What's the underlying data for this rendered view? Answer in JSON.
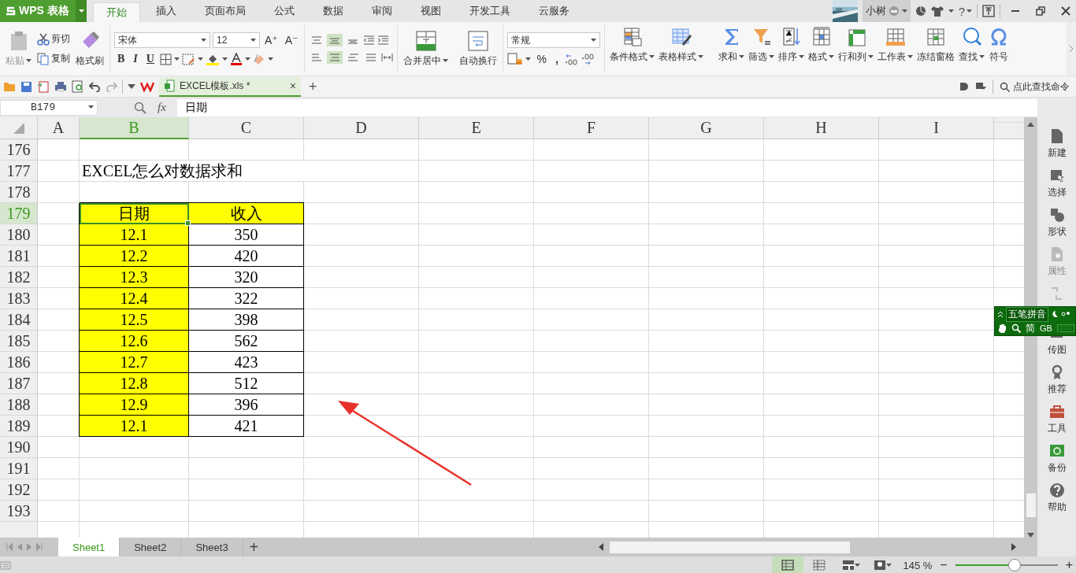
{
  "app": {
    "logo": "WPS 表格"
  },
  "menu_tabs": [
    {
      "label": "开始",
      "selected": true
    },
    {
      "label": "插入",
      "selected": false
    },
    {
      "label": "页面布局",
      "selected": false
    },
    {
      "label": "公式",
      "selected": false
    },
    {
      "label": "数据",
      "selected": false
    },
    {
      "label": "审阅",
      "selected": false
    },
    {
      "label": "视图",
      "selected": false
    },
    {
      "label": "开发工具",
      "selected": false
    },
    {
      "label": "云服务",
      "selected": false
    }
  ],
  "account": {
    "name": "小树",
    "help": "?"
  },
  "ribbon": {
    "clipboard": {
      "paste": "粘贴",
      "cut": "剪切",
      "copy": "复制",
      "format_painter": "格式刷"
    },
    "font": {
      "name": "宋体",
      "size": "12",
      "grow": "A⁺",
      "shrink": "A⁻",
      "bold": "B",
      "italic": "I",
      "underline": "U"
    },
    "alignment": {
      "merge": "合并居中",
      "wrap": "自动换行"
    },
    "number": {
      "format": "常规",
      "percent": "%",
      "comma": ","
    },
    "tools": [
      {
        "label": "条件格式",
        "dropdown": true
      },
      {
        "label": "表格样式",
        "dropdown": true
      },
      {
        "label": "求和",
        "dropdown": true
      },
      {
        "label": "筛选",
        "dropdown": true
      },
      {
        "label": "排序",
        "dropdown": true
      },
      {
        "label": "格式",
        "dropdown": true
      },
      {
        "label": "行和列",
        "dropdown": true
      },
      {
        "label": "工作表",
        "dropdown": true
      },
      {
        "label": "冻结窗格",
        "dropdown": false
      },
      {
        "label": "查找",
        "dropdown": true
      },
      {
        "label": "符号",
        "dropdown": false
      }
    ]
  },
  "document_tab": {
    "title": "EXCEL模板.xls *",
    "close": "×",
    "new": "+"
  },
  "command_search": {
    "placeholder": "点此查找命令"
  },
  "formula_bar": {
    "cell": "B179",
    "fx": "fx",
    "value": "日期"
  },
  "columns": [
    {
      "label": "A",
      "selected": false
    },
    {
      "label": "B",
      "selected": true
    },
    {
      "label": "C",
      "selected": false
    },
    {
      "label": "D",
      "selected": false
    },
    {
      "label": "E",
      "selected": false
    },
    {
      "label": "F",
      "selected": false
    },
    {
      "label": "G",
      "selected": false
    },
    {
      "label": "H",
      "selected": false
    },
    {
      "label": "I",
      "selected": false
    }
  ],
  "rows": [
    {
      "number": "176",
      "selected": false
    },
    {
      "number": "177",
      "selected": false,
      "column_b": {
        "text": "EXCEL怎么对数据求和",
        "highlighted": false,
        "bordered": false,
        "selected": false
      }
    },
    {
      "number": "178",
      "selected": false
    },
    {
      "number": "179",
      "selected": true,
      "column_b": {
        "text": "日期",
        "highlighted": true,
        "bordered": true,
        "selected": true
      },
      "column_c": {
        "text": "收入",
        "highlighted": true,
        "bordered": true,
        "selected": false
      }
    },
    {
      "number": "180",
      "selected": false,
      "column_b": {
        "text": "12.1",
        "highlighted": true,
        "bordered": true,
        "selected": false
      },
      "column_c": {
        "text": "350",
        "highlighted": false,
        "bordered": true,
        "selected": false
      }
    },
    {
      "number": "181",
      "selected": false,
      "column_b": {
        "text": "12.2",
        "highlighted": true,
        "bordered": true,
        "selected": false
      },
      "column_c": {
        "text": "420",
        "highlighted": false,
        "bordered": true,
        "selected": false
      }
    },
    {
      "number": "182",
      "selected": false,
      "column_b": {
        "text": "12.3",
        "highlighted": true,
        "bordered": true,
        "selected": false
      },
      "column_c": {
        "text": "320",
        "highlighted": false,
        "bordered": true,
        "selected": false
      }
    },
    {
      "number": "183",
      "selected": false,
      "column_b": {
        "text": "12.4",
        "highlighted": true,
        "bordered": true,
        "selected": false
      },
      "column_c": {
        "text": "322",
        "highlighted": false,
        "bordered": true,
        "selected": false
      }
    },
    {
      "number": "184",
      "selected": false,
      "column_b": {
        "text": "12.5",
        "highlighted": true,
        "bordered": true,
        "selected": false
      },
      "column_c": {
        "text": "398",
        "highlighted": false,
        "bordered": true,
        "selected": false
      }
    },
    {
      "number": "185",
      "selected": false,
      "column_b": {
        "text": "12.6",
        "highlighted": true,
        "bordered": true,
        "selected": false
      },
      "column_c": {
        "text": "562",
        "highlighted": false,
        "bordered": true,
        "selected": false
      }
    },
    {
      "number": "186",
      "selected": false,
      "column_b": {
        "text": "12.7",
        "highlighted": true,
        "bordered": true,
        "selected": false
      },
      "column_c": {
        "text": "423",
        "highlighted": false,
        "bordered": true,
        "selected": false
      }
    },
    {
      "number": "187",
      "selected": false,
      "column_b": {
        "text": "12.8",
        "highlighted": true,
        "bordered": true,
        "selected": false
      },
      "column_c": {
        "text": "512",
        "highlighted": false,
        "bordered": true,
        "selected": false
      }
    },
    {
      "number": "188",
      "selected": false,
      "column_b": {
        "text": "12.9",
        "highlighted": true,
        "bordered": true,
        "selected": false
      },
      "column_c": {
        "text": "396",
        "highlighted": false,
        "bordered": true,
        "selected": false
      }
    },
    {
      "number": "189",
      "selected": false,
      "column_b": {
        "text": "12.1",
        "highlighted": true,
        "bordered": true,
        "selected": false
      },
      "column_c": {
        "text": "421",
        "highlighted": false,
        "bordered": true,
        "selected": false
      }
    },
    {
      "number": "190",
      "selected": false
    },
    {
      "number": "191",
      "selected": false
    },
    {
      "number": "192",
      "selected": false
    },
    {
      "number": "193",
      "selected": false
    }
  ],
  "sidebar": [
    {
      "label": "新建",
      "disabled": false
    },
    {
      "label": "选择",
      "disabled": false
    },
    {
      "label": "形状",
      "disabled": false
    },
    {
      "label": "属性",
      "disabled": true
    },
    {
      "disabled": true
    },
    {
      "label": "传图",
      "disabled": false
    },
    {
      "label": "推荐",
      "disabled": false
    },
    {
      "label": "工具",
      "disabled": false
    },
    {
      "label": "备份",
      "disabled": false
    },
    {
      "label": "帮助",
      "disabled": false
    }
  ],
  "input_method": {
    "name": "五笔拼音",
    "mode": "简",
    "charset": "GB"
  },
  "sheet_tabs": [
    {
      "label": "Sheet1",
      "selected": true
    },
    {
      "label": "Sheet2",
      "selected": false
    },
    {
      "label": "Sheet3",
      "selected": false
    }
  ],
  "add_sheet": "+",
  "status_bar": {
    "zoom": "145 %",
    "zoom_out": "−",
    "zoom_in": "+",
    "zoom_slider": {
      "level": 0.58
    }
  }
}
